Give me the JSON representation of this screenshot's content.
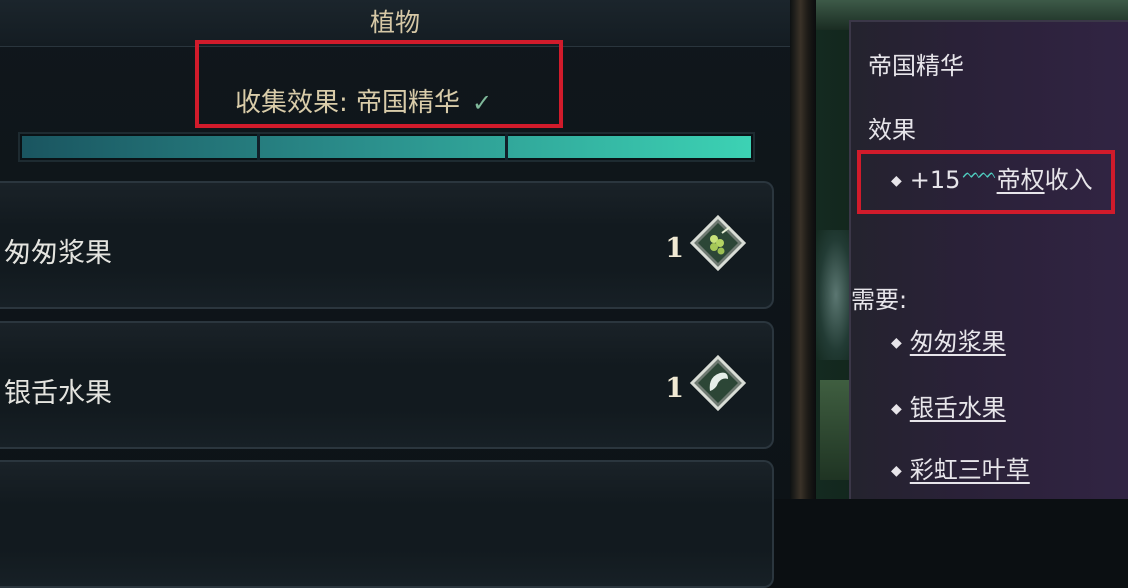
{
  "panel": {
    "title": "植物",
    "collect_effect": "收集效果: 帝国精华",
    "check_icon": "check-icon",
    "progress": {
      "segments": 3,
      "filled": 3,
      "fraction": 1.0
    }
  },
  "items": [
    {
      "name": "匆匆浆果",
      "count": "1",
      "icon": "berry-gem-icon"
    },
    {
      "name": "银舌水果",
      "count": "1",
      "icon": "silvertongue-gem-icon"
    },
    {
      "name": "",
      "count": "",
      "icon": ""
    }
  ],
  "tooltip": {
    "title": "帝国精华",
    "effect_heading": "效果",
    "effect_value": "+15",
    "effect_link": "帝权",
    "effect_suffix": "收入",
    "requires_heading": "需要:",
    "requires": [
      "匆匆浆果",
      "银舌水果",
      "彩虹三叶草"
    ]
  },
  "colors": {
    "highlight": "#d11b2b",
    "accent_teal": "#3cd2b4",
    "title_text": "#d6c8a6"
  }
}
